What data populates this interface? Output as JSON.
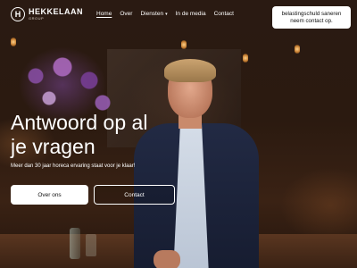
{
  "brand": {
    "mark": "H",
    "name": "HEKKELAAN",
    "sub": "GROUP"
  },
  "nav": {
    "items": [
      {
        "label": "Home",
        "active": true
      },
      {
        "label": "Over"
      },
      {
        "label": "Diensten",
        "dropdown": true
      },
      {
        "label": "In de media"
      },
      {
        "label": "Contact"
      }
    ]
  },
  "cta": {
    "line1": "belastingschuld saneren",
    "line2": "neem contact op."
  },
  "hero": {
    "title_line1": "Antwoord op al",
    "title_line2": "je vragen",
    "subtitle": "Meer dan 30 jaar horeca ervaring staat voor je klaar!",
    "primary_button": "Over ons",
    "secondary_button": "Contact"
  },
  "icons": {
    "logo": "logo-h-icon",
    "dropdown": "chevron-down-icon"
  },
  "colors": {
    "text": "#ffffff",
    "button_bg": "#ffffff",
    "button_text": "#111111"
  }
}
